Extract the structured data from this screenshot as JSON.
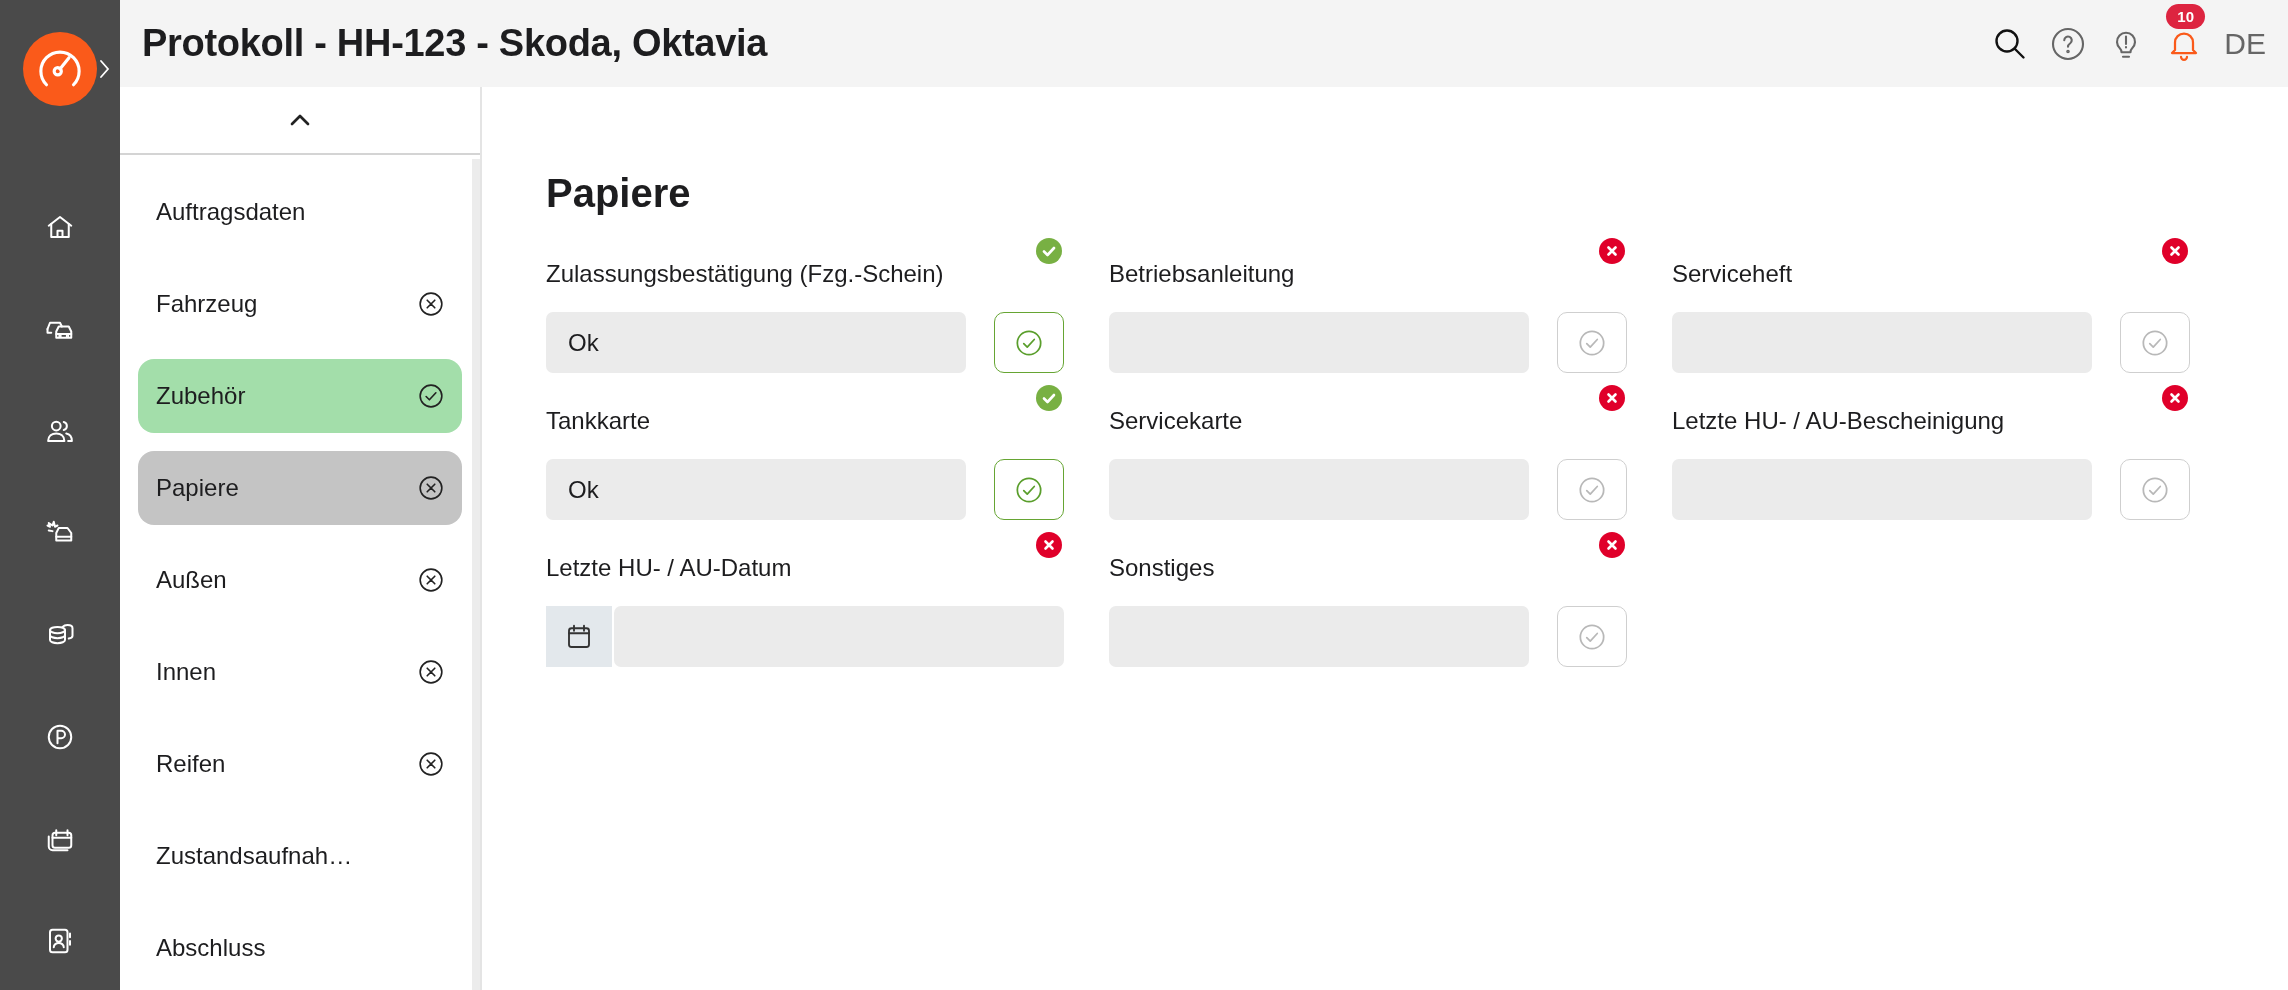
{
  "header": {
    "title": "Protokoll - HH-123 - Skoda, Oktavia",
    "notifications": "10",
    "language": "DE"
  },
  "sidebar": {
    "items": [
      {
        "label": "Auftragsdaten",
        "selected": false
      },
      {
        "label": "Fahrzeug",
        "complete": false,
        "selected": false
      },
      {
        "label": "Zubehör",
        "complete": true,
        "selected": false
      },
      {
        "label": "Papiere",
        "complete": false,
        "selected": true
      },
      {
        "label": "Außen",
        "complete": false,
        "selected": false
      },
      {
        "label": "Innen",
        "complete": false,
        "selected": false
      },
      {
        "label": "Reifen",
        "complete": false,
        "selected": false
      },
      {
        "label": "Zustandsaufnah…",
        "selected": false
      },
      {
        "label": "Abschluss",
        "selected": false
      }
    ]
  },
  "section": {
    "title": "Papiere",
    "fields": [
      {
        "kind": "text",
        "label": "Zulassungsbestätigung (Fzg.-Schein)",
        "value": "Ok",
        "valid": true,
        "confirmed": true
      },
      {
        "kind": "text",
        "label": "Betriebsanleitung",
        "valid": false,
        "confirmed": false
      },
      {
        "kind": "text",
        "label": "Serviceheft",
        "valid": false,
        "confirmed": false
      },
      {
        "kind": "text",
        "label": "Tankkarte",
        "value": "Ok",
        "valid": true,
        "confirmed": true
      },
      {
        "kind": "text",
        "label": "Servicekarte",
        "valid": false,
        "confirmed": false
      },
      {
        "kind": "text",
        "label": "Letzte HU- / AU-Bescheinigung",
        "valid": false,
        "confirmed": false
      },
      {
        "kind": "date",
        "label": "Letzte HU- / AU-Datum",
        "valid": false
      },
      {
        "kind": "text",
        "label": "Sonstiges",
        "valid": false,
        "confirmed": false
      }
    ]
  }
}
